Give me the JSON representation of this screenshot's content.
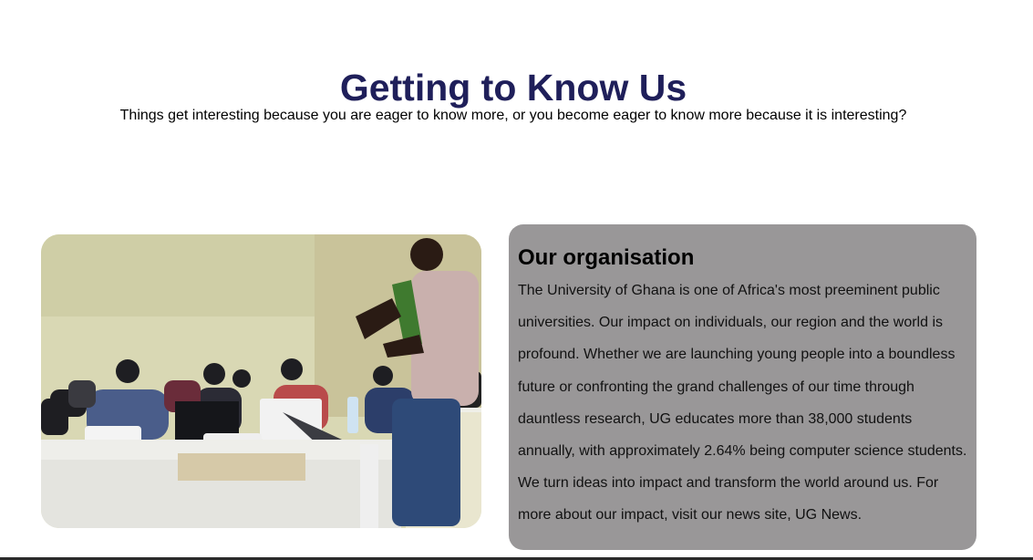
{
  "header": {
    "title": "Getting to Know Us",
    "subtitle": "Things get interesting because you are eager to know more, or you become eager to know more because it is interesting?"
  },
  "about": {
    "title": "Our organisation",
    "body": "The University of Ghana is one of Africa's most preeminent public universities. Our impact on individuals, our region and the world is profound. Whether we are launching young people into a boundless future or confronting the grand challenges of our time through dauntless research, UG educates more than 38,000 students annually, with approximately 2.64% being computer science students. We turn ideas into impact and transform the world around us. For more about our impact, visit our news site, UG News."
  },
  "colors": {
    "heading": "#1f1f5a",
    "card_background": "#999798"
  }
}
